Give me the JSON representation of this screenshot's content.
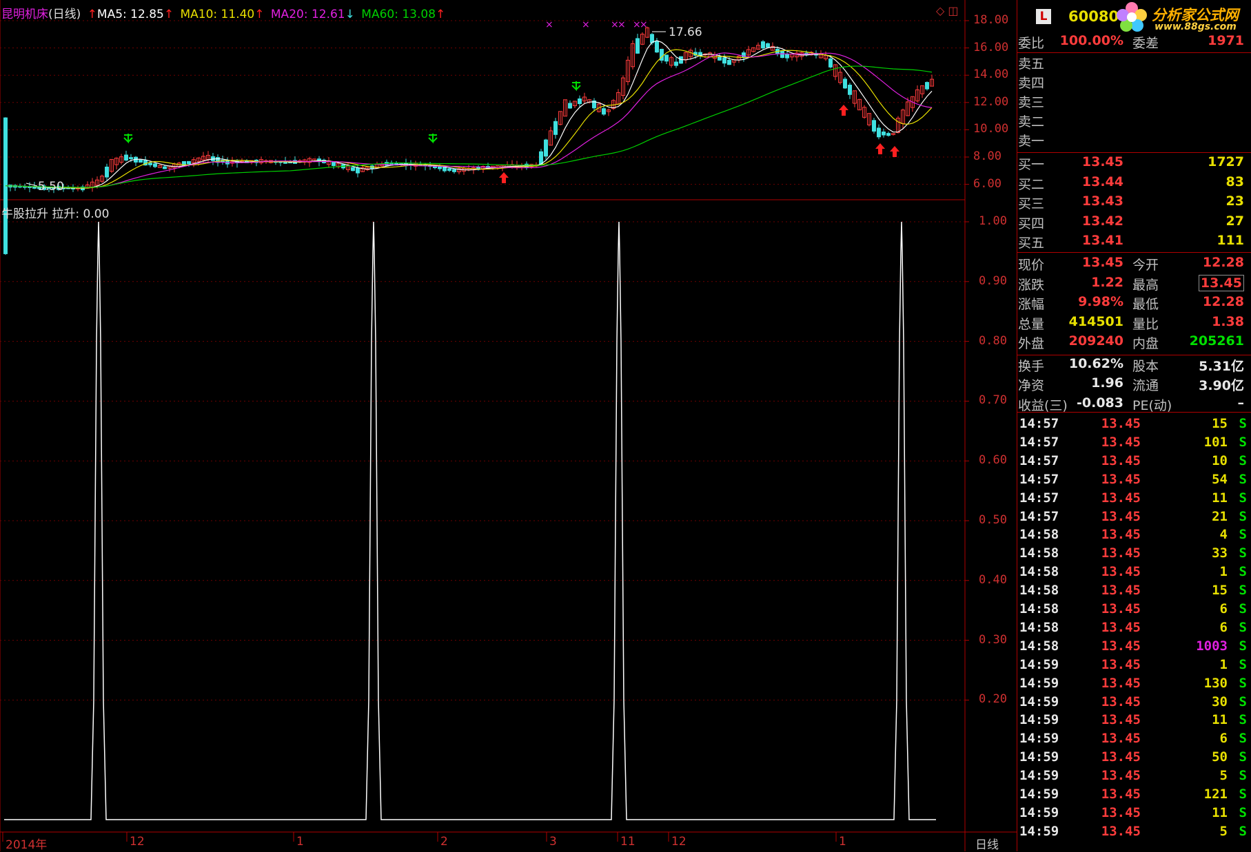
{
  "header": {
    "stock_name": "昆明机床",
    "period_tag": "(日线)",
    "ma5": "MA5: 12.85",
    "ma10": "MA10: 11.40",
    "ma20": "MA20: 12.61",
    "ma60": "MA60: 13.08",
    "arrow_up": "↑",
    "arrow_down": "↓"
  },
  "indicator": {
    "title": "牛股拉升",
    "value": "拉升: 0.00"
  },
  "price_axis": [
    "18.00",
    "16.00",
    "14.00",
    "12.00",
    "10.00",
    "8.00",
    "6.00"
  ],
  "ind_axis": [
    "1.00",
    "0.90",
    "0.80",
    "0.70",
    "0.60",
    "0.50",
    "0.40",
    "0.30",
    "0.20"
  ],
  "price_annotations": {
    "high": "17.66",
    "low": "5.50"
  },
  "date_axis": [
    {
      "label": "2014年"
    },
    {
      "label": "12"
    },
    {
      "label": "1"
    },
    {
      "label": "2"
    },
    {
      "label": "3"
    },
    {
      "label": "11"
    },
    {
      "label": "12"
    },
    {
      "label": "1"
    }
  ],
  "period_label": "日线",
  "colors": {
    "up": "#ff3c3c",
    "down": "#40e0e0",
    "ma5": "#ffffff",
    "ma10": "#e8e000",
    "ma20": "#e020e0",
    "ma60": "#00d000",
    "grid": "#b00000"
  },
  "quote": {
    "logo_letter": "L",
    "code": "60080",
    "watermark": "分析家公式网",
    "watermark_url": "www.88gs.com",
    "weibi_label": "委比",
    "weibi_value": "100.00%",
    "weicha_label": "委差",
    "weicha_value": "1971",
    "sell": [
      {
        "label": "卖五",
        "price": "",
        "vol": ""
      },
      {
        "label": "卖四",
        "price": "",
        "vol": ""
      },
      {
        "label": "卖三",
        "price": "",
        "vol": ""
      },
      {
        "label": "卖二",
        "price": "",
        "vol": ""
      },
      {
        "label": "卖一",
        "price": "",
        "vol": ""
      }
    ],
    "buy": [
      {
        "label": "买一",
        "price": "13.45",
        "vol": "1727"
      },
      {
        "label": "买二",
        "price": "13.44",
        "vol": "83"
      },
      {
        "label": "买三",
        "price": "13.43",
        "vol": "23"
      },
      {
        "label": "买四",
        "price": "13.42",
        "vol": "27"
      },
      {
        "label": "买五",
        "price": "13.41",
        "vol": "111"
      }
    ],
    "stats": [
      {
        "k1": "现价",
        "v1": "13.45",
        "c1": "red",
        "k2": "今开",
        "v2": "12.28",
        "c2": "red"
      },
      {
        "k1": "涨跌",
        "v1": "1.22",
        "c1": "red",
        "k2": "最高",
        "v2": "13.45",
        "c2": "red"
      },
      {
        "k1": "涨幅",
        "v1": "9.98%",
        "c1": "red",
        "k2": "最低",
        "v2": "12.28",
        "c2": "red"
      },
      {
        "k1": "总量",
        "v1": "414501",
        "c1": "yel",
        "k2": "量比",
        "v2": "1.38",
        "c2": "red"
      },
      {
        "k1": "外盘",
        "v1": "209240",
        "c1": "red",
        "k2": "内盘",
        "v2": "205261",
        "c2": "grn"
      },
      {
        "k1": "换手",
        "v1": "10.62%",
        "c1": "wht",
        "k2": "股本",
        "v2": "5.31亿",
        "c2": "wht"
      },
      {
        "k1": "净资",
        "v1": "1.96",
        "c1": "wht",
        "k2": "流通",
        "v2": "3.90亿",
        "c2": "wht"
      },
      {
        "k1": "收益(三)",
        "v1": "-0.083",
        "c1": "wht",
        "k2": "PE(动)",
        "v2": "–",
        "c2": "wht"
      }
    ],
    "ticks": [
      {
        "t": "14:57",
        "p": "13.45",
        "v": "15",
        "f": "S",
        "vc": "yel"
      },
      {
        "t": "14:57",
        "p": "13.45",
        "v": "101",
        "f": "S",
        "vc": "yel"
      },
      {
        "t": "14:57",
        "p": "13.45",
        "v": "10",
        "f": "S",
        "vc": "yel"
      },
      {
        "t": "14:57",
        "p": "13.45",
        "v": "54",
        "f": "S",
        "vc": "yel"
      },
      {
        "t": "14:57",
        "p": "13.45",
        "v": "11",
        "f": "S",
        "vc": "yel"
      },
      {
        "t": "14:57",
        "p": "13.45",
        "v": "21",
        "f": "S",
        "vc": "yel"
      },
      {
        "t": "14:58",
        "p": "13.45",
        "v": "4",
        "f": "S",
        "vc": "yel"
      },
      {
        "t": "14:58",
        "p": "13.45",
        "v": "33",
        "f": "S",
        "vc": "yel"
      },
      {
        "t": "14:58",
        "p": "13.45",
        "v": "1",
        "f": "S",
        "vc": "yel"
      },
      {
        "t": "14:58",
        "p": "13.45",
        "v": "15",
        "f": "S",
        "vc": "yel"
      },
      {
        "t": "14:58",
        "p": "13.45",
        "v": "6",
        "f": "S",
        "vc": "yel"
      },
      {
        "t": "14:58",
        "p": "13.45",
        "v": "6",
        "f": "S",
        "vc": "yel"
      },
      {
        "t": "14:58",
        "p": "13.45",
        "v": "1003",
        "f": "S",
        "vc": "mag"
      },
      {
        "t": "14:59",
        "p": "13.45",
        "v": "1",
        "f": "S",
        "vc": "yel"
      },
      {
        "t": "14:59",
        "p": "13.45",
        "v": "130",
        "f": "S",
        "vc": "yel"
      },
      {
        "t": "14:59",
        "p": "13.45",
        "v": "30",
        "f": "S",
        "vc": "yel"
      },
      {
        "t": "14:59",
        "p": "13.45",
        "v": "11",
        "f": "S",
        "vc": "yel"
      },
      {
        "t": "14:59",
        "p": "13.45",
        "v": "6",
        "f": "S",
        "vc": "yel"
      },
      {
        "t": "14:59",
        "p": "13.45",
        "v": "50",
        "f": "S",
        "vc": "yel"
      },
      {
        "t": "14:59",
        "p": "13.45",
        "v": "5",
        "f": "S",
        "vc": "yel"
      },
      {
        "t": "14:59",
        "p": "13.45",
        "v": "121",
        "f": "S",
        "vc": "yel"
      },
      {
        "t": "14:59",
        "p": "13.45",
        "v": "11",
        "f": "S",
        "vc": "yel"
      },
      {
        "t": "14:59",
        "p": "13.45",
        "v": "5",
        "f": "S",
        "vc": "yel"
      }
    ]
  }
}
